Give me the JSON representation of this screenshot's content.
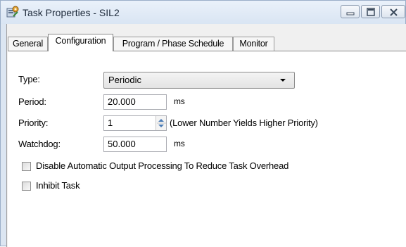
{
  "window": {
    "title": "Task Properties - SIL2",
    "app_icon": "task-properties-icon",
    "controls": [
      "minimize-icon",
      "maximize-icon",
      "close-icon"
    ]
  },
  "tabs": [
    {
      "label": "General",
      "active": false
    },
    {
      "label": "Configuration",
      "active": true
    },
    {
      "label": "Program / Phase Schedule",
      "active": false
    },
    {
      "label": "Monitor",
      "active": false
    }
  ],
  "form": {
    "type": {
      "label": "Type:",
      "value": "Periodic"
    },
    "period": {
      "label": "Period:",
      "value": "20.000",
      "unit": "ms"
    },
    "priority": {
      "label": "Priority:",
      "value": "1",
      "hint": "(Lower Number Yields Higher Priority)"
    },
    "watchdog": {
      "label": "Watchdog:",
      "value": "50.000",
      "unit": "ms"
    },
    "disable_output": {
      "label": "Disable Automatic Output Processing To Reduce Task Overhead",
      "checked": false
    },
    "inhibit": {
      "label": "Inhibit Task",
      "checked": false
    }
  },
  "colors": {
    "title_bg": "#dce6f2",
    "dialog_bg": "#f0f0f0",
    "panel_bg": "#ffffff"
  }
}
